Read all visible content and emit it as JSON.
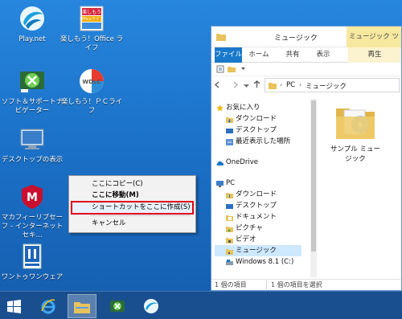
{
  "desktop": {
    "icons": [
      {
        "label": "Play.net",
        "icon": "play-net-icon"
      },
      {
        "label": "楽しもう！Office ライフ",
        "icon": "office-life-icon",
        "art_text": "楽しもう Officeライフ"
      },
      {
        "label": "ソフト＆サポートナビゲーター",
        "icon": "soft-support-navigator-icon"
      },
      {
        "label": "楽しもう！ＰＣライフ",
        "icon": "pc-life-icon",
        "art_text": "WDLC"
      },
      {
        "label": "デスクトップの表示",
        "icon": "show-desktop-icon"
      },
      {
        "label": "マカフィーリブセーフ - インターネットセキ...",
        "icon": "mcafee-icon"
      },
      {
        "label": "ワントゥワンウェア",
        "icon": "one-to-one-ware-icon"
      }
    ]
  },
  "context_menu": {
    "items": [
      {
        "label": "ここにコピー(C)",
        "bold": false
      },
      {
        "label": "ここに移動(M)",
        "bold": true
      },
      {
        "label": "ショートカットをここに作成(S)",
        "highlighted": true
      },
      {
        "label": "キャンセル",
        "bold": false
      }
    ],
    "highlight_color": "#e2001a"
  },
  "explorer": {
    "title": "ミュージック",
    "contextual_tab": "ミュージック ツール",
    "ribbon_tabs": [
      "ファイル",
      "ホーム",
      "共有",
      "表示",
      "再生"
    ],
    "address": [
      "PC",
      "ミュージック"
    ],
    "nav": [
      {
        "label": "お気に入り",
        "icon": "star-icon",
        "level": 0
      },
      {
        "label": "ダウンロード",
        "icon": "download-folder-icon",
        "level": 1
      },
      {
        "label": "デスクトップ",
        "icon": "desktop-folder-icon",
        "level": 1
      },
      {
        "label": "最近表示した場所",
        "icon": "recent-places-icon",
        "level": 1
      },
      {
        "label": "OneDrive",
        "icon": "onedrive-icon",
        "level": 0
      },
      {
        "label": "PC",
        "icon": "pc-icon",
        "level": 0
      },
      {
        "label": "ダウンロード",
        "icon": "download-folder-icon",
        "level": 1
      },
      {
        "label": "デスクトップ",
        "icon": "desktop-folder-icon",
        "level": 1
      },
      {
        "label": "ドキュメント",
        "icon": "documents-folder-icon",
        "level": 1
      },
      {
        "label": "ピクチャ",
        "icon": "pictures-folder-icon",
        "level": 1
      },
      {
        "label": "ビデオ",
        "icon": "videos-folder-icon",
        "level": 1
      },
      {
        "label": "ミュージック",
        "icon": "music-folder-icon",
        "level": 1,
        "selected": true
      },
      {
        "label": "Windows 8.1 (C:)",
        "icon": "drive-icon",
        "level": 1
      }
    ],
    "content_items": [
      {
        "label": "サンプル ミュージック",
        "icon": "music-folder-icon"
      }
    ],
    "status": {
      "items": "1 個の項目",
      "selected": "1 個の項目を選択"
    }
  },
  "taskbar": {
    "items": [
      {
        "name": "start-button",
        "icon": "windows-logo-icon"
      },
      {
        "name": "ie-button",
        "icon": "internet-explorer-icon"
      },
      {
        "name": "explorer-button",
        "icon": "file-explorer-icon",
        "active": true
      },
      {
        "name": "navigator-button",
        "icon": "soft-support-navigator-icon"
      },
      {
        "name": "play-net-button",
        "icon": "play-net-icon"
      }
    ]
  },
  "colors": {
    "desktop_bg": "#2786dd",
    "taskbar_bg": "#1a4f8f",
    "ribbon_file_tab": "#1979ca",
    "contextual_tab_bg": "#f7e8a0"
  }
}
